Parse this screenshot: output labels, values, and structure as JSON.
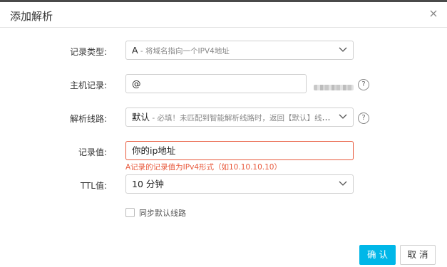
{
  "dialog": {
    "title": "添加解析"
  },
  "form": {
    "record_type": {
      "label": "记录类型:",
      "value_main": "A",
      "value_sub": " - 将域名指向一个IPV4地址"
    },
    "host_record": {
      "label": "主机记录:",
      "value": "@",
      "help": "?"
    },
    "line": {
      "label": "解析线路:",
      "value_main": "默认",
      "value_sub": " - 必填！未匹配到智能解析线路时，返回【默认】线路...",
      "help": "?"
    },
    "record_value": {
      "label": "记录值:",
      "value": "你的ip地址",
      "error": "A记录的记录值为IPv4形式（如10.10.10.10）"
    },
    "ttl": {
      "label": "TTL值:",
      "value": "10 分钟"
    },
    "sync_default": {
      "label": "同步默认线路",
      "checked": false
    }
  },
  "actions": {
    "confirm": "确 认",
    "cancel": "取 消"
  },
  "colors": {
    "primary": "#00b7e8",
    "error": "#e8593c"
  }
}
